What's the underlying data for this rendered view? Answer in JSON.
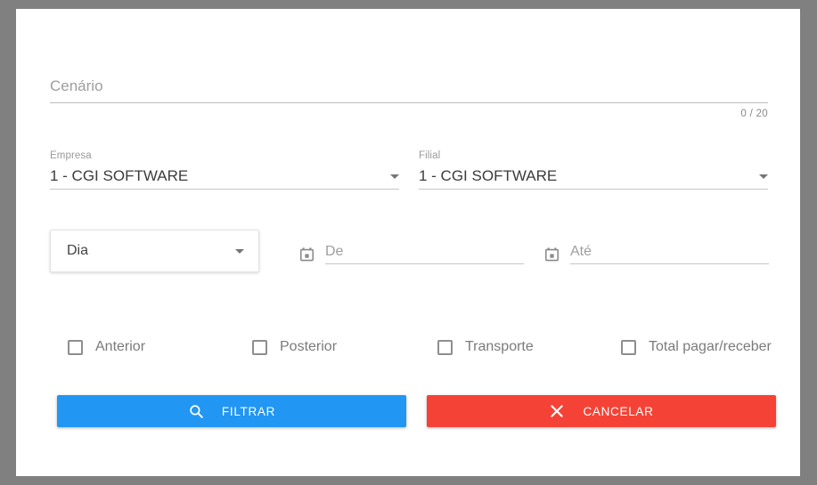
{
  "theme": {
    "backdrop_color": "#808080",
    "dialog_color": "#ffffff",
    "primary_color": "#2196f3",
    "danger_color": "#f44336",
    "label_color": "#9a9a9a",
    "text_color": "#3c3c3c",
    "placeholder_color": "#9e9e9e"
  },
  "form": {
    "cenario": {
      "placeholder": "Cenário",
      "value": "",
      "counter": "0 / 20"
    },
    "empresa": {
      "label": "Empresa",
      "value": "1 - CGI SOFTWARE"
    },
    "filial": {
      "label": "Filial",
      "value": "1 - CGI SOFTWARE"
    },
    "periodo": {
      "value": "Dia"
    },
    "date_from": {
      "placeholder": "De",
      "value": "",
      "icon": "calendar-icon"
    },
    "date_to": {
      "placeholder": "Até",
      "value": "",
      "icon": "calendar-icon"
    },
    "checkboxes": [
      {
        "label": "Anterior",
        "checked": false,
        "name": "anterior"
      },
      {
        "label": "Posterior",
        "checked": false,
        "name": "posterior"
      },
      {
        "label": "Transporte",
        "checked": false,
        "name": "transporte"
      },
      {
        "label": "Total pagar/receber",
        "checked": false,
        "name": "total-pagar-receber"
      }
    ]
  },
  "actions": {
    "filter": {
      "label": "FILTRAR",
      "icon": "search-icon",
      "color": "#2196f3"
    },
    "cancel": {
      "label": "CANCELAR",
      "icon": "close-icon",
      "color": "#f44336"
    }
  }
}
